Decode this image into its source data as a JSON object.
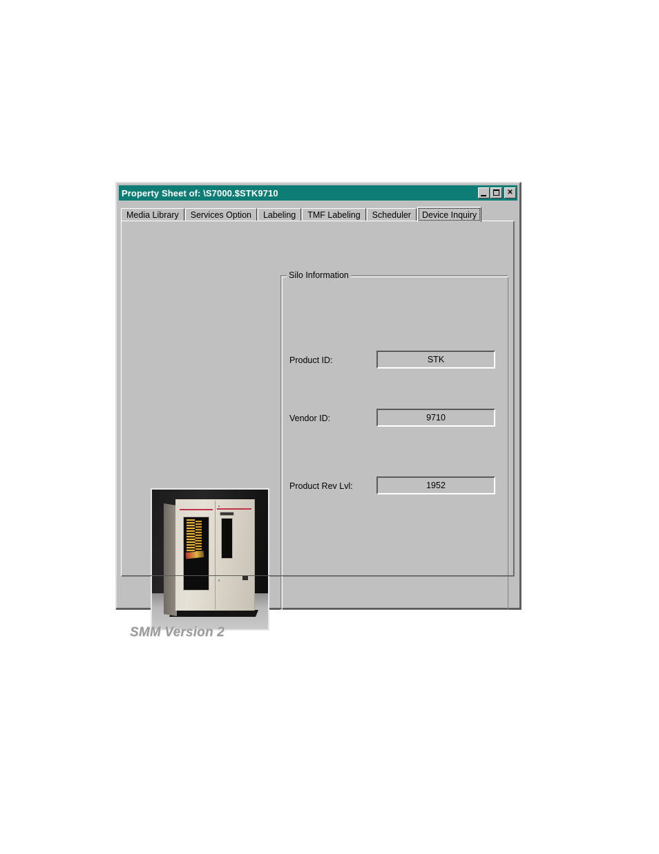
{
  "window": {
    "title": "Property Sheet of: \\S7000.$STK9710",
    "title_bar_color": "#0e7d76",
    "face_color": "#c0c0c0",
    "controls": [
      {
        "name": "minimize",
        "label": "_"
      },
      {
        "name": "maximize",
        "label": "□"
      },
      {
        "name": "close",
        "label": "✕"
      }
    ]
  },
  "tabs": [
    {
      "label": "Media Library",
      "active": false
    },
    {
      "label": "Services Option",
      "active": false
    },
    {
      "label": "Labeling",
      "active": false
    },
    {
      "label": "TMF Labeling",
      "active": false
    },
    {
      "label": "Scheduler",
      "active": false
    },
    {
      "label": "Device Inquiry",
      "active": true
    }
  ],
  "groupbox": {
    "label": "Silo Information",
    "fields": [
      {
        "label": "Product ID:",
        "value": "STK"
      },
      {
        "label": "Vendor ID:",
        "value": "9710"
      },
      {
        "label": "Product Rev Lvl:",
        "value": "1952"
      }
    ]
  },
  "photo": {
    "alt": "StorageTek tape silo cabinet photograph"
  },
  "footer": {
    "version": "SMM Version 2"
  }
}
